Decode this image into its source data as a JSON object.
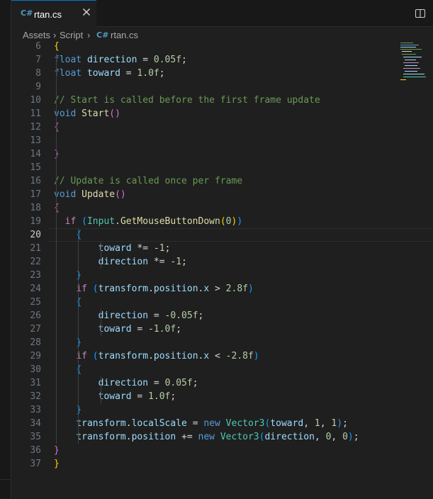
{
  "tab": {
    "label": "rtan.cs",
    "icon": "csharp-file-icon",
    "icon_glyph": "C#"
  },
  "breadcrumb": {
    "items": [
      "Assets",
      "Script",
      "rtan.cs"
    ]
  },
  "editor": {
    "active_line": 20,
    "lines": [
      {
        "n": "6",
        "t": [
          [
            "{",
            "#ffd700"
          ]
        ]
      },
      {
        "n": "7",
        "t": [
          [
            "float",
            "#569cd6"
          ],
          [
            " ",
            ""
          ],
          [
            "direction",
            "#9cdcfe"
          ],
          [
            " = ",
            ""
          ],
          [
            "0.05f",
            "#b5cea8"
          ],
          [
            ";",
            ""
          ]
        ]
      },
      {
        "n": "8",
        "t": [
          [
            "float",
            "#569cd6"
          ],
          [
            " ",
            ""
          ],
          [
            "toward",
            "#9cdcfe"
          ],
          [
            " = ",
            ""
          ],
          [
            "1.0f",
            "#b5cea8"
          ],
          [
            ";",
            ""
          ]
        ]
      },
      {
        "n": "9",
        "t": []
      },
      {
        "n": "10",
        "t": [
          [
            "// Start is called before the first frame update",
            "#6a9955"
          ]
        ]
      },
      {
        "n": "11",
        "t": [
          [
            "void",
            "#569cd6"
          ],
          [
            " ",
            ""
          ],
          [
            "Start",
            "#dcdcaa"
          ],
          [
            "()",
            "#da70d6"
          ]
        ]
      },
      {
        "n": "12",
        "t": [
          [
            "{",
            "#da70d6"
          ]
        ]
      },
      {
        "n": "13",
        "t": []
      },
      {
        "n": "14",
        "t": [
          [
            "}",
            "#da70d6"
          ]
        ]
      },
      {
        "n": "15",
        "t": []
      },
      {
        "n": "16",
        "t": [
          [
            "// Update is called once per frame",
            "#6a9955"
          ]
        ]
      },
      {
        "n": "17",
        "t": [
          [
            "void",
            "#569cd6"
          ],
          [
            " ",
            ""
          ],
          [
            "Update",
            "#dcdcaa"
          ],
          [
            "()",
            "#da70d6"
          ]
        ]
      },
      {
        "n": "18",
        "t": [
          [
            "{",
            "#da70d6"
          ]
        ]
      },
      {
        "n": "19",
        "t": [
          [
            "  ",
            ""
          ],
          [
            "if",
            "#c586c0"
          ],
          [
            " ",
            ""
          ],
          [
            "(",
            "#179fff"
          ],
          [
            "Input",
            "#4ec9b0"
          ],
          [
            ".",
            ""
          ],
          [
            "GetMouseButtonDown",
            "#dcdcaa"
          ],
          [
            "(",
            "#ffd700"
          ],
          [
            "0",
            "#b5cea8"
          ],
          [
            ")",
            "#ffd700"
          ],
          [
            ")",
            "#179fff"
          ]
        ]
      },
      {
        "n": "20",
        "t": [
          [
            "    ",
            ""
          ],
          [
            "{",
            "#179fff"
          ]
        ]
      },
      {
        "n": "21",
        "t": [
          [
            "        ",
            ""
          ],
          [
            "toward",
            "#9cdcfe"
          ],
          [
            " *= -",
            ""
          ],
          [
            "1",
            "#b5cea8"
          ],
          [
            ";",
            ""
          ]
        ]
      },
      {
        "n": "22",
        "t": [
          [
            "        ",
            ""
          ],
          [
            "direction",
            "#9cdcfe"
          ],
          [
            " *= -",
            ""
          ],
          [
            "1",
            "#b5cea8"
          ],
          [
            ";",
            ""
          ]
        ]
      },
      {
        "n": "23",
        "t": [
          [
            "    ",
            ""
          ],
          [
            "}",
            "#179fff"
          ]
        ]
      },
      {
        "n": "24",
        "t": [
          [
            "    ",
            ""
          ],
          [
            "if",
            "#c586c0"
          ],
          [
            " ",
            ""
          ],
          [
            "(",
            "#179fff"
          ],
          [
            "transform",
            "#9cdcfe"
          ],
          [
            ".",
            ""
          ],
          [
            "position",
            "#9cdcfe"
          ],
          [
            ".",
            ""
          ],
          [
            "x",
            "#9cdcfe"
          ],
          [
            " > ",
            ""
          ],
          [
            "2.8f",
            "#b5cea8"
          ],
          [
            ")",
            "#179fff"
          ]
        ]
      },
      {
        "n": "25",
        "t": [
          [
            "    ",
            ""
          ],
          [
            "{",
            "#179fff"
          ]
        ]
      },
      {
        "n": "26",
        "t": [
          [
            "        ",
            ""
          ],
          [
            "direction",
            "#9cdcfe"
          ],
          [
            " = -",
            ""
          ],
          [
            "0.05f",
            "#b5cea8"
          ],
          [
            ";",
            ""
          ]
        ]
      },
      {
        "n": "27",
        "t": [
          [
            "        ",
            ""
          ],
          [
            "toward",
            "#9cdcfe"
          ],
          [
            " = -",
            ""
          ],
          [
            "1.0f",
            "#b5cea8"
          ],
          [
            ";",
            ""
          ]
        ]
      },
      {
        "n": "28",
        "t": [
          [
            "    ",
            ""
          ],
          [
            "}",
            "#179fff"
          ]
        ]
      },
      {
        "n": "29",
        "t": [
          [
            "    ",
            ""
          ],
          [
            "if",
            "#c586c0"
          ],
          [
            " ",
            ""
          ],
          [
            "(",
            "#179fff"
          ],
          [
            "transform",
            "#9cdcfe"
          ],
          [
            ".",
            ""
          ],
          [
            "position",
            "#9cdcfe"
          ],
          [
            ".",
            ""
          ],
          [
            "x",
            "#9cdcfe"
          ],
          [
            " < -",
            ""
          ],
          [
            "2.8f",
            "#b5cea8"
          ],
          [
            ")",
            "#179fff"
          ]
        ]
      },
      {
        "n": "30",
        "t": [
          [
            "    ",
            ""
          ],
          [
            "{",
            "#179fff"
          ]
        ]
      },
      {
        "n": "31",
        "t": [
          [
            "        ",
            ""
          ],
          [
            "direction",
            "#9cdcfe"
          ],
          [
            " = ",
            ""
          ],
          [
            "0.05f",
            "#b5cea8"
          ],
          [
            ";",
            ""
          ]
        ]
      },
      {
        "n": "32",
        "t": [
          [
            "        ",
            ""
          ],
          [
            "toward",
            "#9cdcfe"
          ],
          [
            " = ",
            ""
          ],
          [
            "1.0f",
            "#b5cea8"
          ],
          [
            ";",
            ""
          ]
        ]
      },
      {
        "n": "33",
        "t": [
          [
            "    ",
            ""
          ],
          [
            "}",
            "#179fff"
          ]
        ]
      },
      {
        "n": "34",
        "t": [
          [
            "    ",
            ""
          ],
          [
            "transform",
            "#9cdcfe"
          ],
          [
            ".",
            ""
          ],
          [
            "localScale",
            "#9cdcfe"
          ],
          [
            " = ",
            ""
          ],
          [
            "new",
            "#569cd6"
          ],
          [
            " ",
            ""
          ],
          [
            "Vector3",
            "#4ec9b0"
          ],
          [
            "(",
            "#179fff"
          ],
          [
            "toward",
            "#9cdcfe"
          ],
          [
            ", ",
            ""
          ],
          [
            "1",
            "#b5cea8"
          ],
          [
            ", ",
            ""
          ],
          [
            "1",
            "#b5cea8"
          ],
          [
            ")",
            "#179fff"
          ],
          [
            ";",
            ""
          ]
        ]
      },
      {
        "n": "35",
        "t": [
          [
            "    ",
            ""
          ],
          [
            "transform",
            "#9cdcfe"
          ],
          [
            ".",
            ""
          ],
          [
            "position",
            "#9cdcfe"
          ],
          [
            " += ",
            ""
          ],
          [
            "new",
            "#569cd6"
          ],
          [
            " ",
            ""
          ],
          [
            "Vector3",
            "#4ec9b0"
          ],
          [
            "(",
            "#179fff"
          ],
          [
            "direction",
            "#9cdcfe"
          ],
          [
            ", ",
            ""
          ],
          [
            "0",
            "#b5cea8"
          ],
          [
            ", ",
            ""
          ],
          [
            "0",
            "#b5cea8"
          ],
          [
            ")",
            "#179fff"
          ],
          [
            ";",
            ""
          ]
        ]
      },
      {
        "n": "36",
        "t": [
          [
            "}",
            "#da70d6"
          ]
        ]
      },
      {
        "n": "37",
        "t": [
          [
            "}",
            "#ffd700"
          ]
        ]
      }
    ]
  },
  "colors": {
    "background": "#1f1f1f",
    "accent": "#0078d4",
    "plain_text": "#d4d4d4"
  },
  "icons": [
    "csharp-file-icon",
    "close-icon",
    "split-editor-icon",
    "chevron-right-icon"
  ]
}
